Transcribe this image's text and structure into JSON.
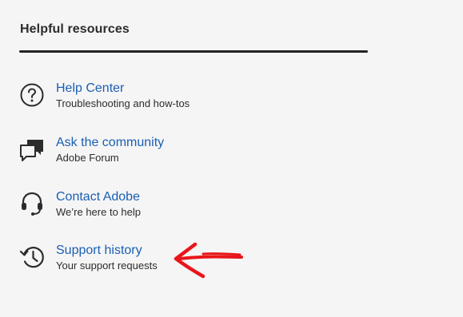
{
  "section": {
    "title": "Helpful resources"
  },
  "resources": [
    {
      "icon": "question-circle-icon",
      "title": "Help Center",
      "subtitle": "Troubleshooting and how-tos"
    },
    {
      "icon": "chat-bubbles-icon",
      "title": "Ask the community",
      "subtitle": "Adobe Forum"
    },
    {
      "icon": "headset-icon",
      "title": "Contact Adobe",
      "subtitle": "We’re here to help"
    },
    {
      "icon": "history-clock-icon",
      "title": "Support history",
      "subtitle": "Your support requests"
    }
  ],
  "colors": {
    "link": "#1a5fb4",
    "text": "#2c2c2c",
    "background": "#f5f5f5",
    "annotation": "#e8161b"
  }
}
